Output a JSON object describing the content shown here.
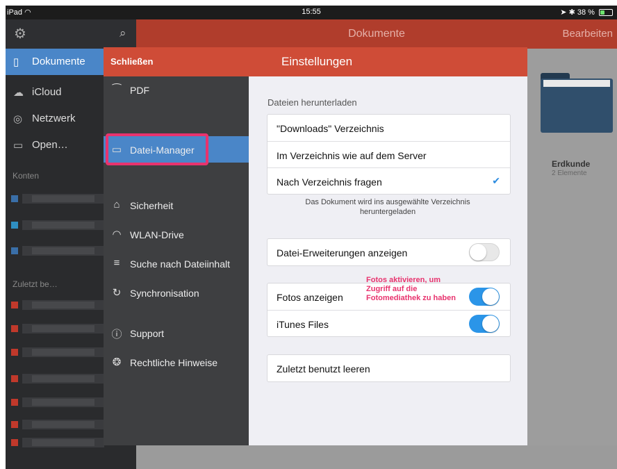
{
  "status": {
    "device": "iPad",
    "time": "15:55",
    "battery": "38 %",
    "battery_level": 0.38,
    "icons": [
      "wifi-icon",
      "location-icon",
      "bluetooth-icon",
      "battery-icon"
    ]
  },
  "sidebar": {
    "items": [
      {
        "label": "Dokumente",
        "icon": "document-icon"
      },
      {
        "label": "iCloud",
        "icon": "cloud-icon"
      },
      {
        "label": "Netzwerk",
        "icon": "network-icon"
      },
      {
        "label": "Open…",
        "icon": "folder-icon"
      }
    ],
    "accounts_header": "Konten",
    "recent_header": "Zuletzt be…"
  },
  "topbar": {
    "title": "Dokumente",
    "edit": "Bearbeiten"
  },
  "folder": {
    "name": "Erdkunde",
    "count": "2 Elemente"
  },
  "modal": {
    "close": "Schließen",
    "title": "Einstellungen",
    "menu": [
      {
        "label": "PDF",
        "icon": "pdf-icon"
      },
      {
        "label": "Datei-Manager",
        "icon": "folder-icon",
        "selected": true
      },
      {
        "label": "Sicherheit",
        "icon": "lock-icon"
      },
      {
        "label": "WLAN-Drive",
        "icon": "wifi-icon"
      },
      {
        "label": "Suche nach Dateiinhalt",
        "icon": "search-content-icon"
      },
      {
        "label": "Synchronisation",
        "icon": "sync-icon"
      },
      {
        "label": "Support",
        "icon": "help-icon"
      },
      {
        "label": "Rechtliche Hinweise",
        "icon": "badge-icon"
      }
    ],
    "section_download": "Dateien herunterladen",
    "download_options": [
      {
        "label": "\"Downloads\" Verzeichnis",
        "checked": false
      },
      {
        "label": "Im Verzeichnis wie auf dem Server",
        "checked": false
      },
      {
        "label": "Nach Verzeichnis fragen",
        "checked": true
      }
    ],
    "download_note": "Das Dokument wird ins ausgewählte Verzeichnis heruntergeladen",
    "show_extensions": {
      "label": "Datei-Erweiterungen anzeigen",
      "on": false
    },
    "show_photos": {
      "label": "Fotos anzeigen",
      "on": true
    },
    "itunes_files": {
      "label": "iTunes Files",
      "on": true
    },
    "clear_recent": "Zuletzt benutzt leeren",
    "annotation": "Fotos aktivieren, um Zugriff auf die Fotomediathek zu haben"
  },
  "colors": {
    "accent": "#cf4c37",
    "selected": "#4a86c8",
    "toggle_on": "#2b95e8",
    "highlight": "#e8336e"
  }
}
